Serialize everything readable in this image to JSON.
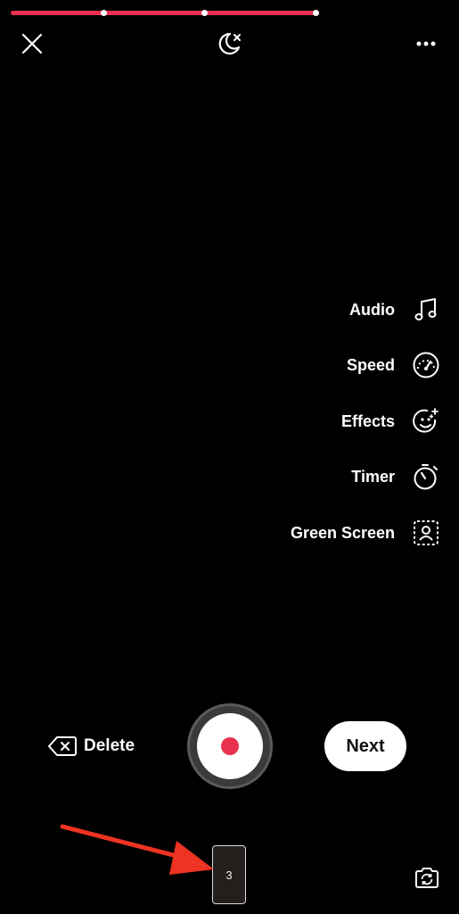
{
  "progress": {
    "segments": 3,
    "color": "#e8314f"
  },
  "top_bar": {
    "close_icon": "close-icon",
    "night_mode_icon": "moon-off-icon",
    "more_icon": "more-options-icon"
  },
  "side_tools": [
    {
      "label": "Audio",
      "icon": "music-note-icon"
    },
    {
      "label": "Speed",
      "icon": "speedometer-icon"
    },
    {
      "label": "Effects",
      "icon": "sparkle-face-icon"
    },
    {
      "label": "Timer",
      "icon": "timer-icon"
    },
    {
      "label": "Green Screen",
      "icon": "green-screen-icon"
    }
  ],
  "controls": {
    "delete_label": "Delete",
    "next_label": "Next",
    "record_color": "#e8314f"
  },
  "clips": {
    "count_label": "3"
  },
  "annotation": {
    "arrow_color": "#ee3322"
  }
}
